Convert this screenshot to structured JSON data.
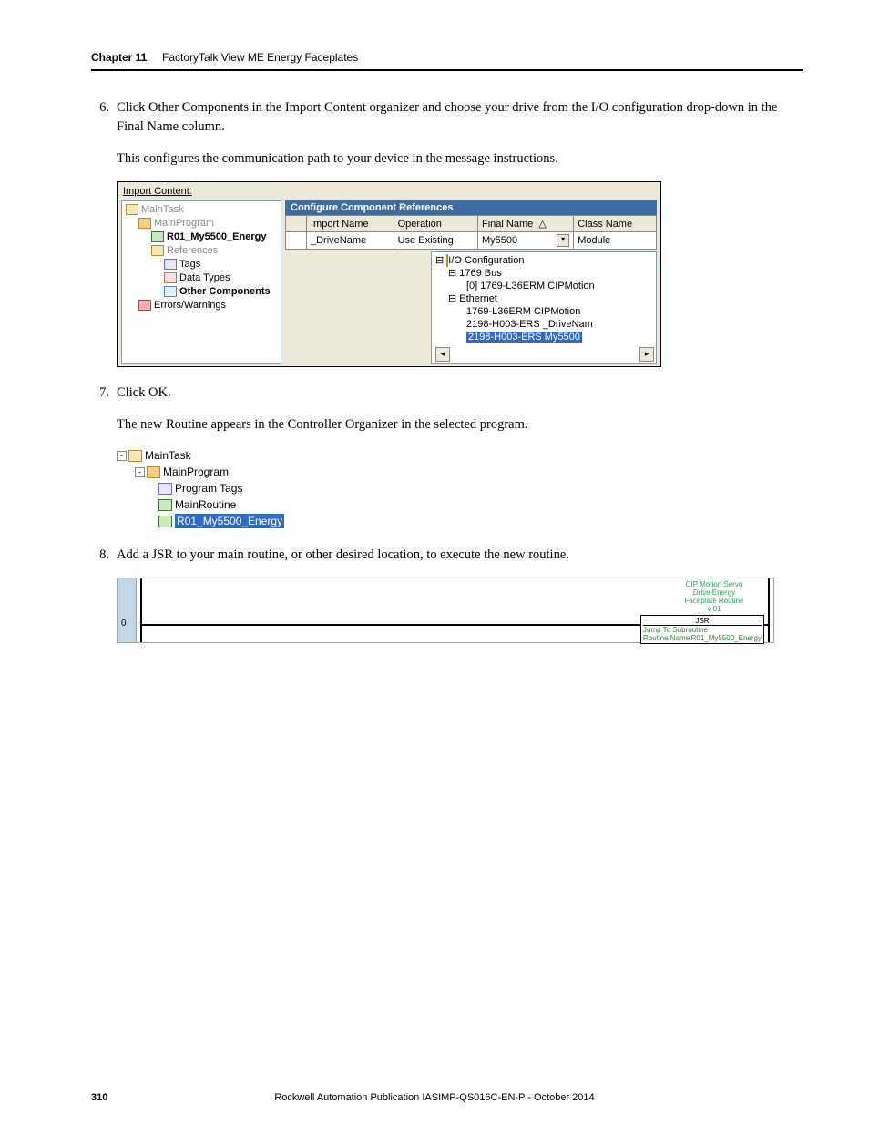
{
  "header": {
    "chapter": "Chapter 11",
    "title": "FactoryTalk View ME Energy Faceplates"
  },
  "steps": {
    "6": {
      "num": "6.",
      "text": "Click Other Components in the Import Content organizer and choose your drive from the I/O configuration drop-down in the Final Name column.",
      "para": "This configures the communication path to your device in the message instructions."
    },
    "7": {
      "num": "7.",
      "text": "Click OK.",
      "para": "The new Routine appears in the Controller Organizer in the selected program."
    },
    "8": {
      "num": "8.",
      "text": "Add a JSR to your main routine, or other desired location, to execute the new routine."
    }
  },
  "fig1": {
    "caption": "Import Content:",
    "tree": {
      "root": "MainTask",
      "prog": "MainProgram",
      "routine": "R01_My5500_Energy",
      "refs": "References",
      "tags": "Tags",
      "dtypes": "Data Types",
      "other": "Other Components",
      "errs": "Errors/Warnings"
    },
    "grid": {
      "title": "Configure Component References",
      "h1": "Import Name",
      "h2": "Operation",
      "h3": "Final Name",
      "h4": "Class Name",
      "r1c1": "_DriveName",
      "r1c2": "Use Existing",
      "r1c3": "My5500",
      "r1c4": "Module"
    },
    "dd": {
      "root": "I/O Configuration",
      "bus": "1769 Bus",
      "bus_item": "[0] 1769-L36ERM CIPMotion",
      "eth": "Ethernet",
      "eth1": "1769-L36ERM CIPMotion",
      "eth2": "2198-H003-ERS _DriveNam",
      "eth3": "2198-H003-ERS My5500"
    }
  },
  "fig2": {
    "root": "MainTask",
    "prog": "MainProgram",
    "tags": "Program Tags",
    "main": "MainRoutine",
    "new": "R01_My5500_Energy"
  },
  "fig3": {
    "rung": "0",
    "cmt1": "CIP Motion Servo",
    "cmt2": "Drive Energy",
    "cmt3": "Faceplate Routine",
    "cmt4": "v 01",
    "blk_top": "JSR",
    "blk_l1": "Jump To Subroutine",
    "blk_l2a": "Routine Name",
    "blk_l2b": "R01_My5500_Energy"
  },
  "footer": {
    "page": "310",
    "text": "Rockwell Automation Publication IASIMP-QS016C-EN-P - October 2014"
  }
}
